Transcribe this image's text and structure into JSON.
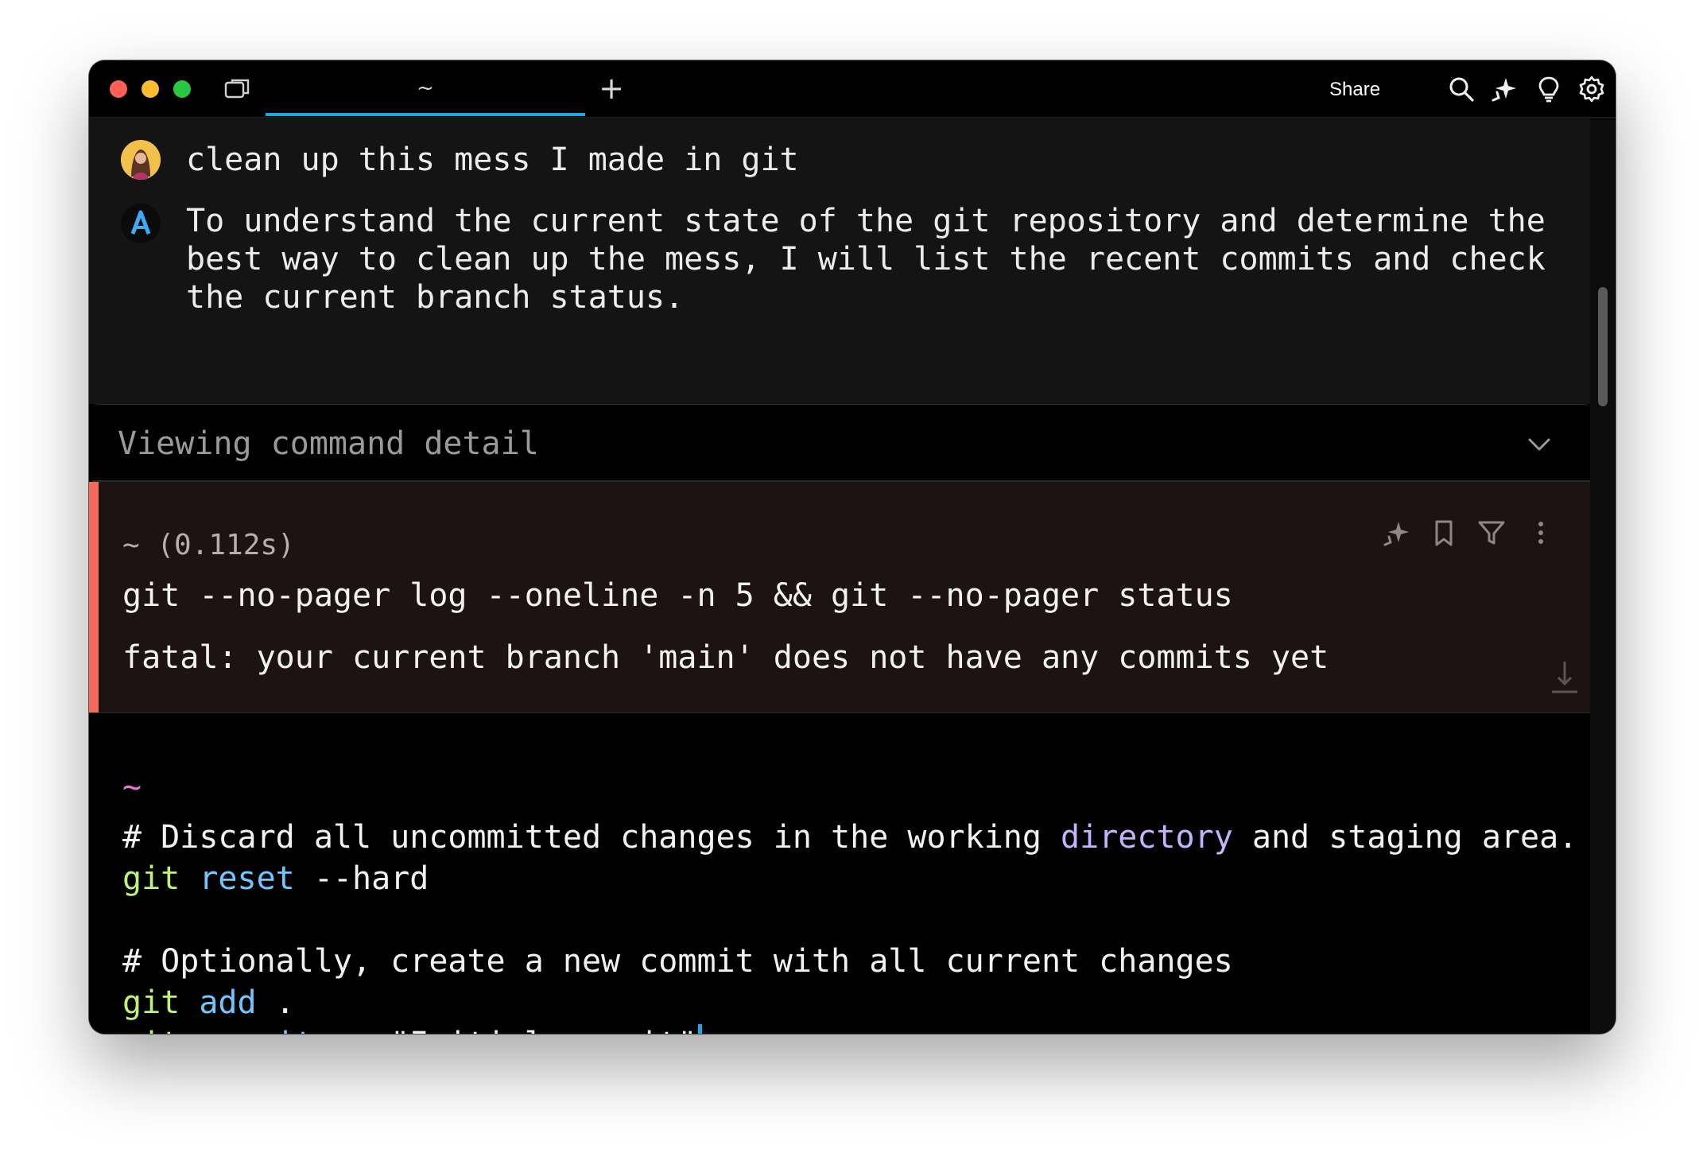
{
  "titlebar": {
    "tab_label": "~",
    "new_tab": "+",
    "share_label": "Share",
    "icons": [
      "panel-icon",
      "search-icon",
      "ai-sparkle-icon",
      "lightbulb-icon",
      "gear-icon"
    ]
  },
  "conversation": {
    "user_message": "clean up this mess I made in git",
    "agent_message": "To understand the current state of the git repository and determine the\nbest way to clean up the mess, I will list the recent commits and check\nthe current branch status."
  },
  "detail": {
    "title": "Viewing command detail"
  },
  "command_block": {
    "meta": "~ (0.112s)",
    "command": "git --no-pager log --oneline -n 5 && git --no-pager status",
    "output": "fatal: your current branch 'main' does not have any commits yet",
    "accent_color": "#f26a5a"
  },
  "editor": {
    "prompt": "~",
    "comment1_a": "# Discard all uncommitted changes in the working ",
    "comment1_dir": "directory",
    "comment1_b": " and staging area.",
    "line2_git": "git",
    "line2_sub": " reset",
    "line2_flag": " --hard",
    "comment2": "# Optionally, create a new commit with all current changes",
    "line4_git": "git",
    "line4_sub": " add",
    "line4_arg": " .",
    "line5_git": "git",
    "line5_sub": " commit",
    "line5_arg": " -m \"Initial commit\""
  },
  "colors": {
    "accent_tab": "#1aa7e6",
    "prompt": "#f072d8",
    "git_keyword": "#bff27a",
    "subcommand": "#6fc7ff"
  }
}
